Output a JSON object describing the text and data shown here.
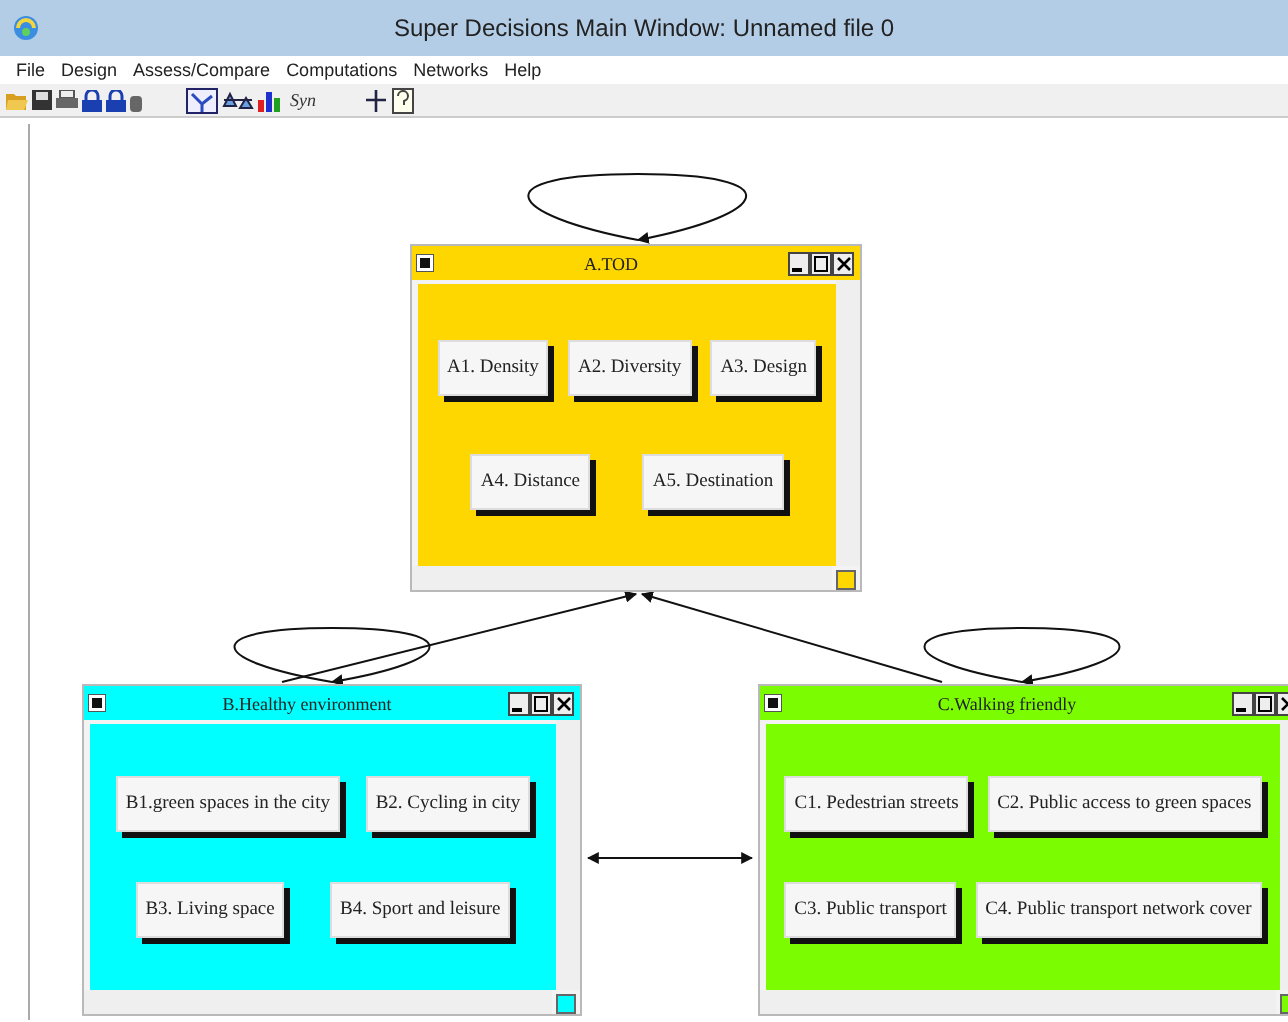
{
  "window": {
    "title": "Super Decisions Main Window: Unnamed file 0"
  },
  "menu": [
    "File",
    "Design",
    "Assess/Compare",
    "Computations",
    "Networks",
    "Help"
  ],
  "toolbar": {
    "syn_label": "Syn"
  },
  "clusters": [
    {
      "title": "A.TOD",
      "color": "#ffd700",
      "node_rows": [
        [
          "A1. Density",
          "A2. Diversity",
          "A3. Design"
        ],
        [
          "A4. Distance",
          "A5. Destination"
        ]
      ]
    },
    {
      "title": "B.Healthy environment",
      "color": "#00ffff",
      "node_rows": [
        [
          "B1.green spaces in the  city",
          "B2. Cycling in city"
        ],
        [
          "B3. Living space",
          "B4. Sport and leisure"
        ]
      ]
    },
    {
      "title": "C.Walking friendly",
      "color": "#7cfc00",
      "node_rows": [
        [
          "C1. Pedestrian streets",
          "C2. Public access to green spaces"
        ],
        [
          "C3. Public transport",
          "C4. Public transport network cover"
        ]
      ]
    }
  ]
}
